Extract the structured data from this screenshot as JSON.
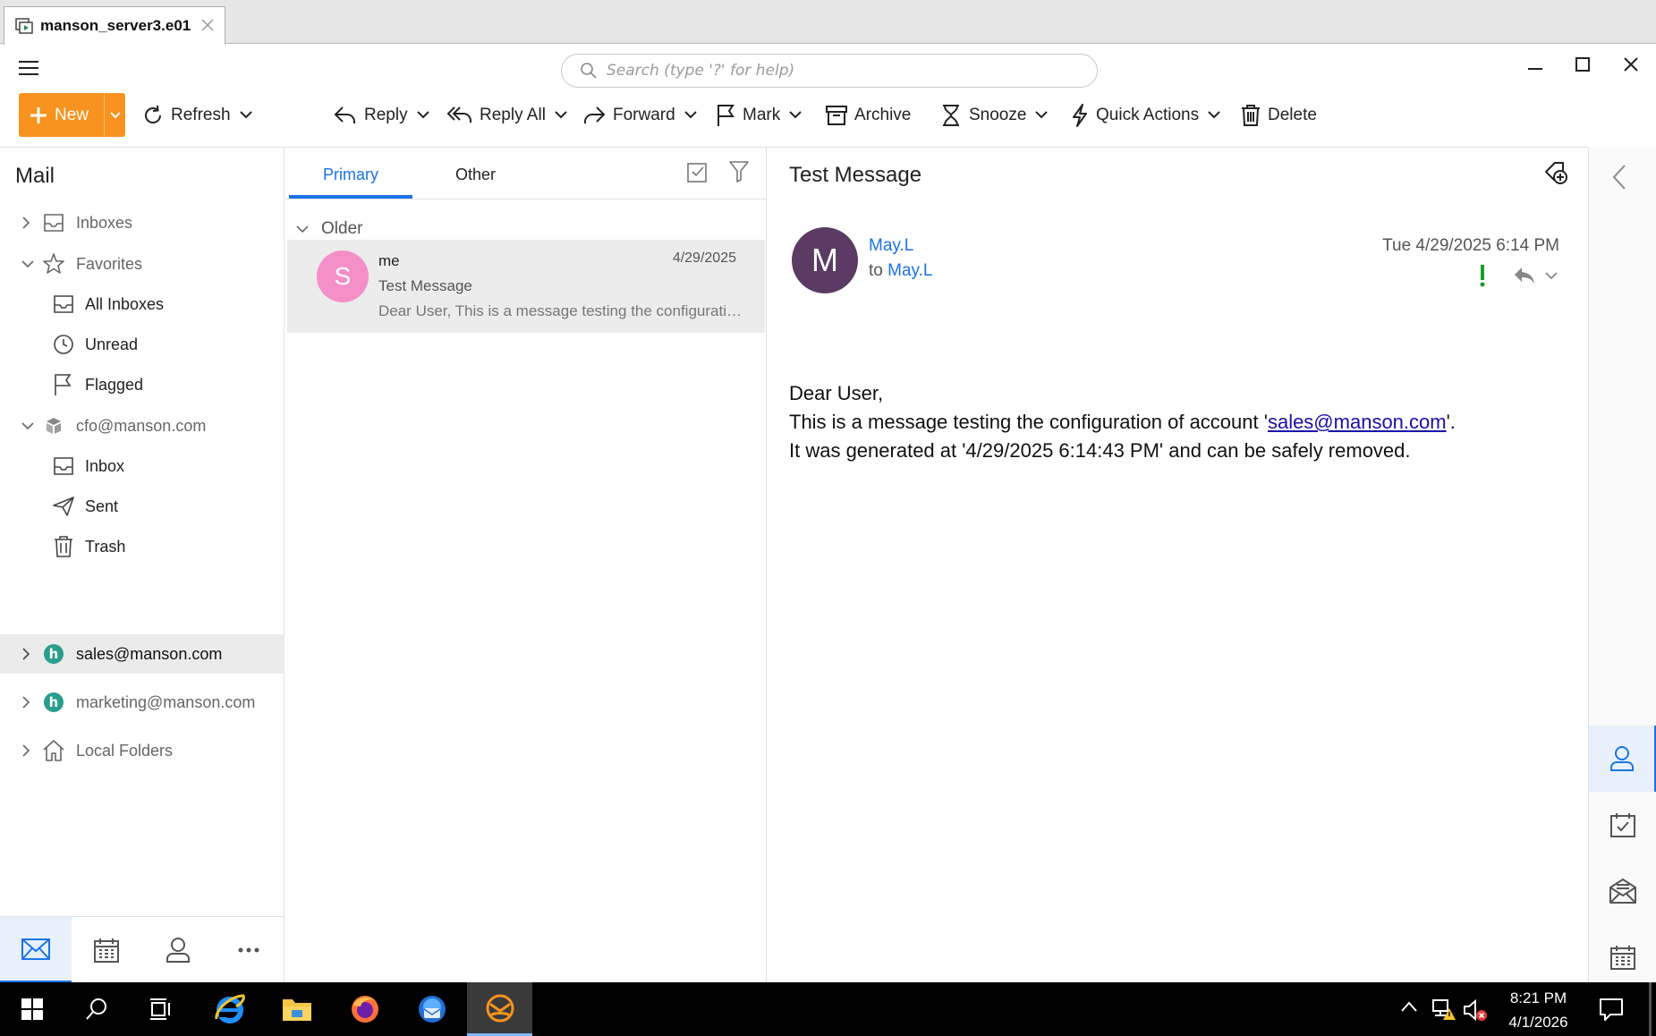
{
  "vm_tab": {
    "title": "manson_server3.e01"
  },
  "search": {
    "placeholder": "Search (type '?' for help)"
  },
  "toolbar": {
    "new_label": "New",
    "refresh_label": "Refresh",
    "reply_label": "Reply",
    "reply_all_label": "Reply All",
    "forward_label": "Forward",
    "mark_label": "Mark",
    "archive_label": "Archive",
    "snooze_label": "Snooze",
    "quick_actions_label": "Quick Actions",
    "delete_label": "Delete"
  },
  "nav": {
    "title": "Mail",
    "inboxes": "Inboxes",
    "favorites": "Favorites",
    "all_inboxes": "All Inboxes",
    "unread": "Unread",
    "flagged": "Flagged",
    "account1": "cfo@manson.com",
    "inbox": "Inbox",
    "sent": "Sent",
    "trash": "Trash",
    "account2": "sales@manson.com",
    "account3": "marketing@manson.com",
    "local_folders": "Local Folders"
  },
  "list": {
    "tab_primary": "Primary",
    "tab_other": "Other",
    "group": "Older",
    "messages": [
      {
        "avatar_letter": "S",
        "from": "me",
        "date": "4/29/2025",
        "subject": "Test Message",
        "preview": "Dear User, This is a message testing the configuration of account"
      }
    ]
  },
  "reader": {
    "subject": "Test Message",
    "avatar_letter": "M",
    "sender": "May.L",
    "to_prefix": "to",
    "to": "May.L",
    "date": "Tue 4/29/2025 6:14 PM",
    "body_line1": "Dear User,",
    "body_line2_pre": "This is a message testing the configuration of account '",
    "body_link": "sales@manson.com",
    "body_line2_post": "'.",
    "body_line3": "It was generated at '4/29/2025 6:14:43 PM' and can be safely removed."
  },
  "taskbar": {
    "time": "8:21 PM",
    "date": "4/1/2026"
  },
  "colors": {
    "accent": "#1a73e8",
    "new_button": "#f7931e",
    "sender_avatar": "#5b3a63",
    "list_avatar": "#f48fc8",
    "account_icon": "#2a9d8f"
  }
}
